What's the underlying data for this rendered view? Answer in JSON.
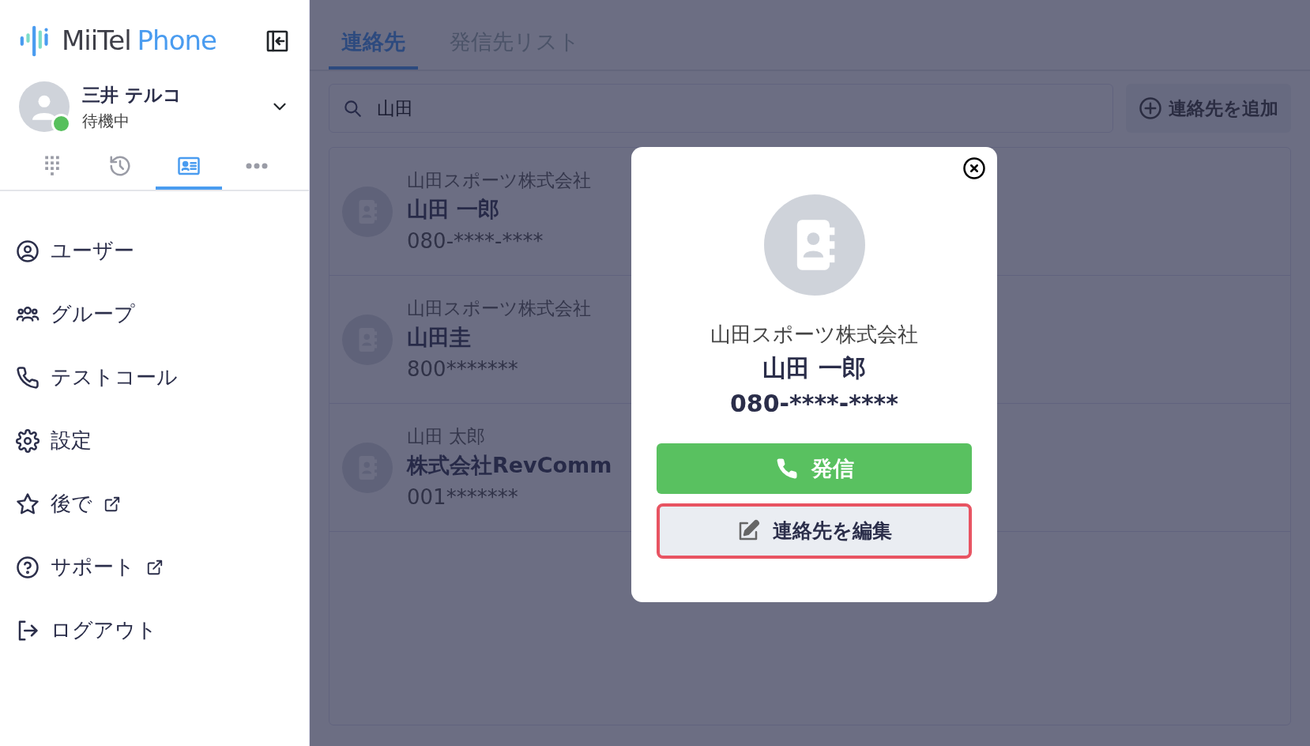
{
  "logo": {
    "word_1": "MiiTel",
    "word_2": "Phone"
  },
  "user": {
    "name": "三井 テルコ",
    "status": "待機中",
    "online": true
  },
  "nav_tabs": [
    {
      "kind": "keypad",
      "selected": false
    },
    {
      "kind": "history",
      "selected": false
    },
    {
      "kind": "contacts",
      "selected": true
    },
    {
      "kind": "more",
      "selected": false
    }
  ],
  "menu": [
    {
      "kind": "user",
      "label": "ユーザー",
      "external": false
    },
    {
      "kind": "group",
      "label": "グループ",
      "external": false
    },
    {
      "kind": "phone",
      "label": "テストコール",
      "external": false
    },
    {
      "kind": "settings",
      "label": "設定",
      "external": false
    },
    {
      "kind": "star",
      "label": "後で",
      "external": true
    },
    {
      "kind": "help",
      "label": "サポート",
      "external": true
    },
    {
      "kind": "logout",
      "label": "ログアウト",
      "external": false
    }
  ],
  "tabs": [
    {
      "label": "連絡先",
      "selected": true
    },
    {
      "label": "発信先リスト",
      "selected": false
    }
  ],
  "search": {
    "value": "山田"
  },
  "add_button": {
    "label": "連絡先を追加"
  },
  "contacts": [
    {
      "subtitle": "山田スポーツ株式会社",
      "name": "山田 一郎",
      "number": "080-****-****"
    },
    {
      "subtitle": "山田スポーツ株式会社",
      "name": "山田圭",
      "number": "800*******"
    },
    {
      "subtitle": "山田 太郎",
      "name": "株式会社RevComm",
      "number": "001*******"
    }
  ],
  "dialog": {
    "company": "山田スポーツ株式会社",
    "name": "山田 一郎",
    "number": "080-****-****",
    "call_button": "発信",
    "edit_button": {
      "label": "連絡先を編集",
      "highlighted": true
    }
  }
}
